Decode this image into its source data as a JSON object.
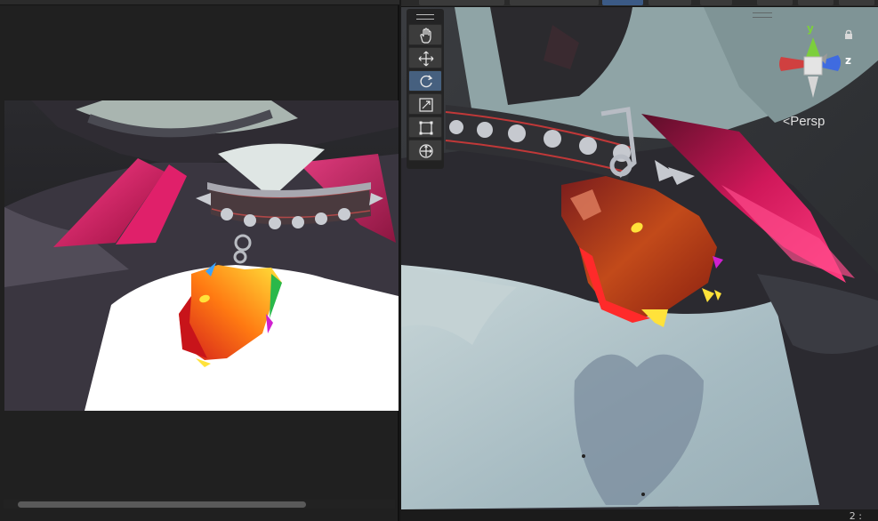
{
  "scene_view": {
    "projection_label": "Persp",
    "corner_text": "2 :",
    "axis_labels": {
      "y": "y",
      "z": "z"
    }
  },
  "tools": {
    "items": [
      {
        "name": "hand",
        "icon": "hand-icon",
        "active": false
      },
      {
        "name": "move",
        "icon": "move-icon",
        "active": false
      },
      {
        "name": "rotate",
        "icon": "rotate-icon",
        "active": true
      },
      {
        "name": "scale",
        "icon": "scale-icon",
        "active": false
      },
      {
        "name": "rect",
        "icon": "rect-transform-icon",
        "active": false
      },
      {
        "name": "transform",
        "icon": "transform-icon",
        "active": false
      }
    ]
  },
  "colors": {
    "axis_x": "#d04040",
    "axis_y": "#7ccf3c",
    "axis_z": "#3f6be0",
    "active_tool": "#46607f"
  }
}
